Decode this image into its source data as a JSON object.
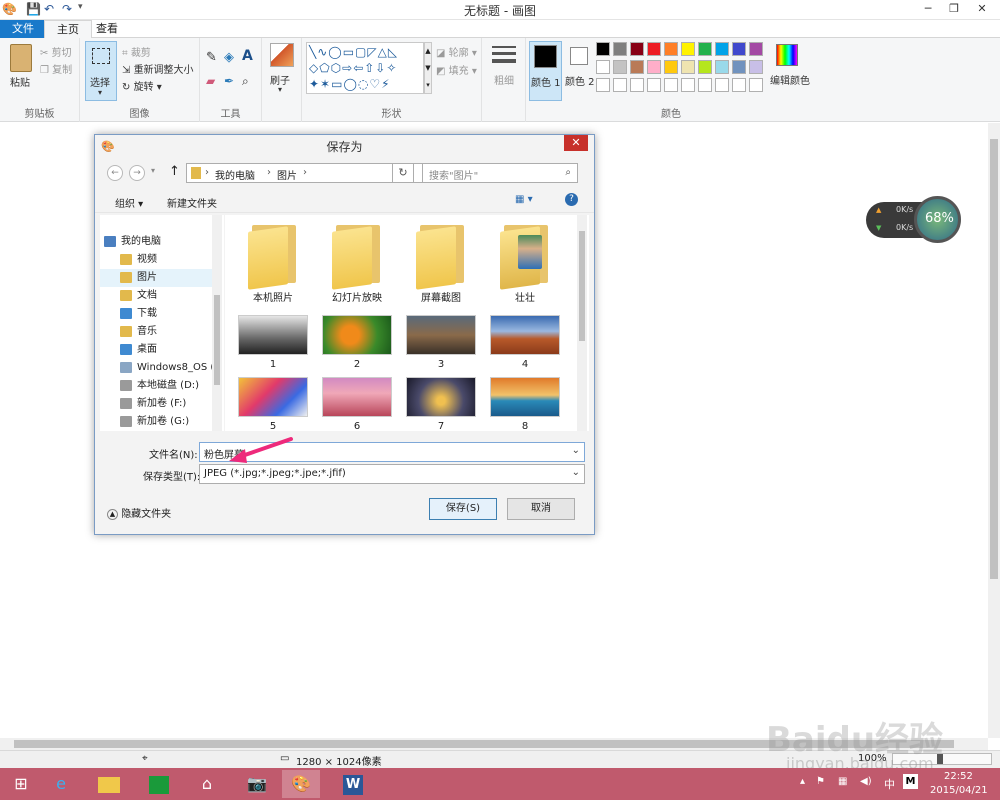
{
  "window": {
    "title": "无标题 - 画图"
  },
  "tabs": [
    {
      "label": "文件"
    },
    {
      "label": "主页"
    },
    {
      "label": "查看"
    }
  ],
  "ribbon": {
    "clipboard": {
      "paste": "粘贴",
      "cut": "剪切",
      "copy": "复制",
      "label": "剪贴板"
    },
    "image": {
      "select": "选择",
      "crop": "裁剪",
      "resize": "重新调整大小",
      "rotate": "旋转",
      "label": "图像"
    },
    "tools": {
      "label": "工具"
    },
    "brushes": {
      "label": "刷子"
    },
    "shapes": {
      "outline": "轮廓",
      "fill": "填充",
      "label": "形状"
    },
    "size": {
      "label": "粗细"
    },
    "colors": {
      "color1": "颜色 1",
      "color2": "颜色 2",
      "edit": "编辑颜色",
      "label": "颜色",
      "palette_row1": [
        "#000000",
        "#7f7f7f",
        "#880015",
        "#ed1c24",
        "#ff7f27",
        "#fff200",
        "#22b14c",
        "#00a2e8",
        "#3f48cc",
        "#a349a4"
      ],
      "palette_row2": [
        "#ffffff",
        "#c3c3c3",
        "#b97a57",
        "#ffaec9",
        "#ffc90e",
        "#efe4b0",
        "#b5e61d",
        "#99d9ea",
        "#7092be",
        "#c8bfe7"
      ]
    }
  },
  "dialog": {
    "title": "保存为",
    "breadcrumb": [
      "我的电脑",
      "图片"
    ],
    "search_placeholder": "搜索\"图片\"",
    "organize": "组织",
    "new_folder": "新建文件夹",
    "nav": [
      {
        "label": "我的电脑"
      },
      {
        "label": "视频"
      },
      {
        "label": "图片"
      },
      {
        "label": "文档"
      },
      {
        "label": "下载"
      },
      {
        "label": "音乐"
      },
      {
        "label": "桌面"
      },
      {
        "label": "Windows8_OS ("
      },
      {
        "label": "本地磁盘 (D:)"
      },
      {
        "label": "新加卷 (F:)"
      },
      {
        "label": "新加卷 (G:)"
      }
    ],
    "folders": [
      {
        "label": "本机照片"
      },
      {
        "label": "幻灯片放映"
      },
      {
        "label": "屏幕截图"
      },
      {
        "label": "壮壮"
      }
    ],
    "images": [
      {
        "label": "1"
      },
      {
        "label": "2"
      },
      {
        "label": "3"
      },
      {
        "label": "4"
      },
      {
        "label": "5"
      },
      {
        "label": "6"
      },
      {
        "label": "7"
      },
      {
        "label": "8"
      }
    ],
    "filename_label": "文件名(N):",
    "filename_value": "粉色屏幕",
    "filetype_label": "保存类型(T):",
    "filetype_value": "JPEG (*.jpg;*.jpeg;*.jpe;*.jfif)",
    "hide_folders": "隐藏文件夹",
    "save": "保存(S)",
    "cancel": "取消"
  },
  "status": {
    "dimensions": "1280 × 1024像素",
    "zoom": "100%"
  },
  "widget": {
    "up": "0K/s",
    "down": "0K/s",
    "percent": "68%"
  },
  "taskbar": {
    "time": "22:52",
    "date": "2015/04/21",
    "ime": "中"
  },
  "watermark": {
    "text": "Baidu经验",
    "sub": "jingyan.baidu.com"
  }
}
